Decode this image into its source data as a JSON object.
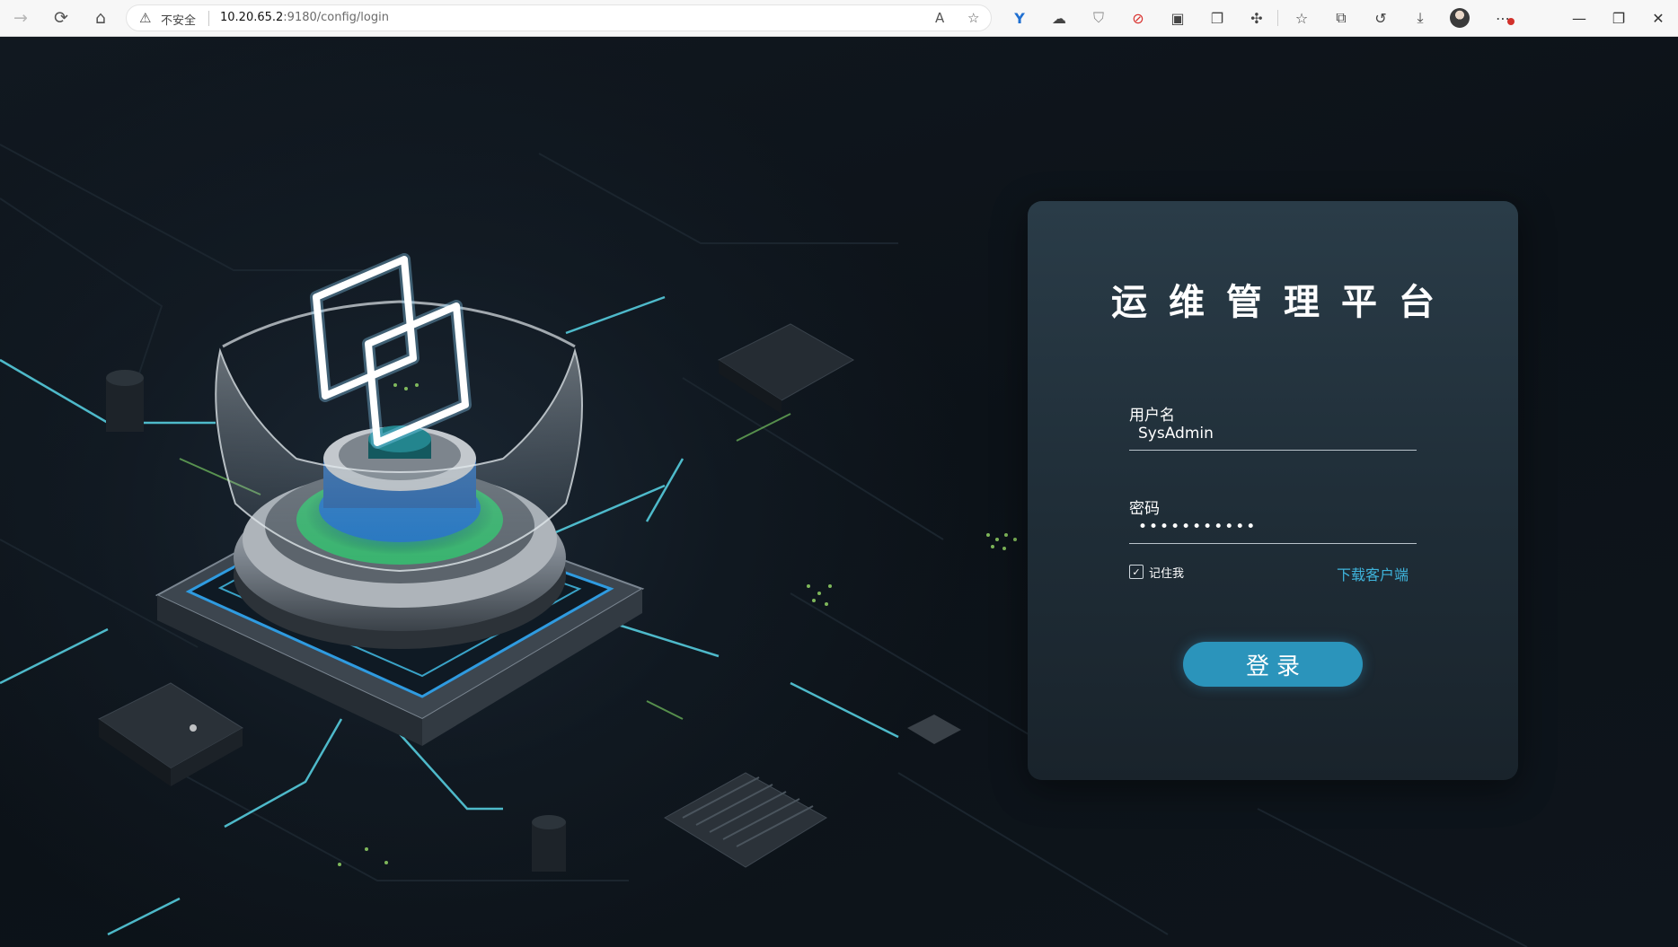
{
  "browser": {
    "security_label": "不安全",
    "url_host": "10.20.65.2",
    "url_rest": ":9180/config/login"
  },
  "login": {
    "title": "运维管理平台",
    "username_label": "用户名",
    "username_value": "SysAdmin",
    "password_label": "密码",
    "password_value": "•••••••••••",
    "remember_label": "记住我",
    "remember_checked": true,
    "download_link": "下载客户端",
    "login_button": "登录"
  },
  "colors": {
    "accent": "#2b94bb",
    "link": "#3fb4dc",
    "card": "#243540"
  }
}
